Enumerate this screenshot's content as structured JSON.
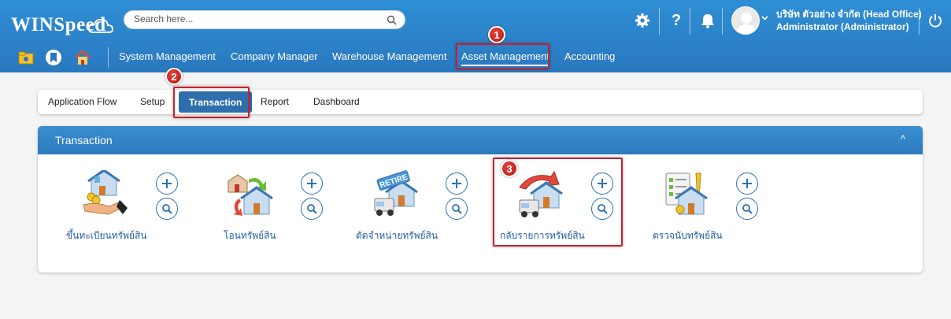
{
  "app": {
    "logo_text": "WINSpeed"
  },
  "search": {
    "placeholder": "Search here..."
  },
  "user": {
    "company": "บริษัท ตัวอย่าง จำกัด (Head Office)",
    "name": "Administrator (Administrator)"
  },
  "nav": {
    "items": [
      {
        "label": "System Management"
      },
      {
        "label": "Company Manager"
      },
      {
        "label": "Warehouse Management"
      },
      {
        "label": "Asset Management"
      },
      {
        "label": "Accounting"
      }
    ]
  },
  "tabs": [
    {
      "label": "Application Flow"
    },
    {
      "label": "Setup"
    },
    {
      "label": "Transaction"
    },
    {
      "label": "Report"
    },
    {
      "label": "Dashboard"
    }
  ],
  "panel": {
    "title": "Transaction",
    "items": [
      {
        "label": "ขึ้นทะเบียนทรัพย์สิน",
        "icon": "asset-register-icon"
      },
      {
        "label": "โอนทรัพย์สิน",
        "icon": "asset-transfer-icon"
      },
      {
        "label": "ตัดจำหน่ายทรัพย์สิน",
        "icon": "asset-retire-icon",
        "icon_text": "RETIRE"
      },
      {
        "label": "กลับรายการทรัพย์สิน",
        "icon": "asset-reverse-icon"
      },
      {
        "label": "ตรวจนับทรัพย์สิน",
        "icon": "asset-count-icon"
      }
    ]
  },
  "annotations": {
    "badges": [
      "1",
      "2",
      "3"
    ],
    "highlight_color": "#c8202e"
  },
  "colors": {
    "header": "#2f8fd4",
    "active_tab": "#2f6eac",
    "link": "#1f5fa5"
  }
}
